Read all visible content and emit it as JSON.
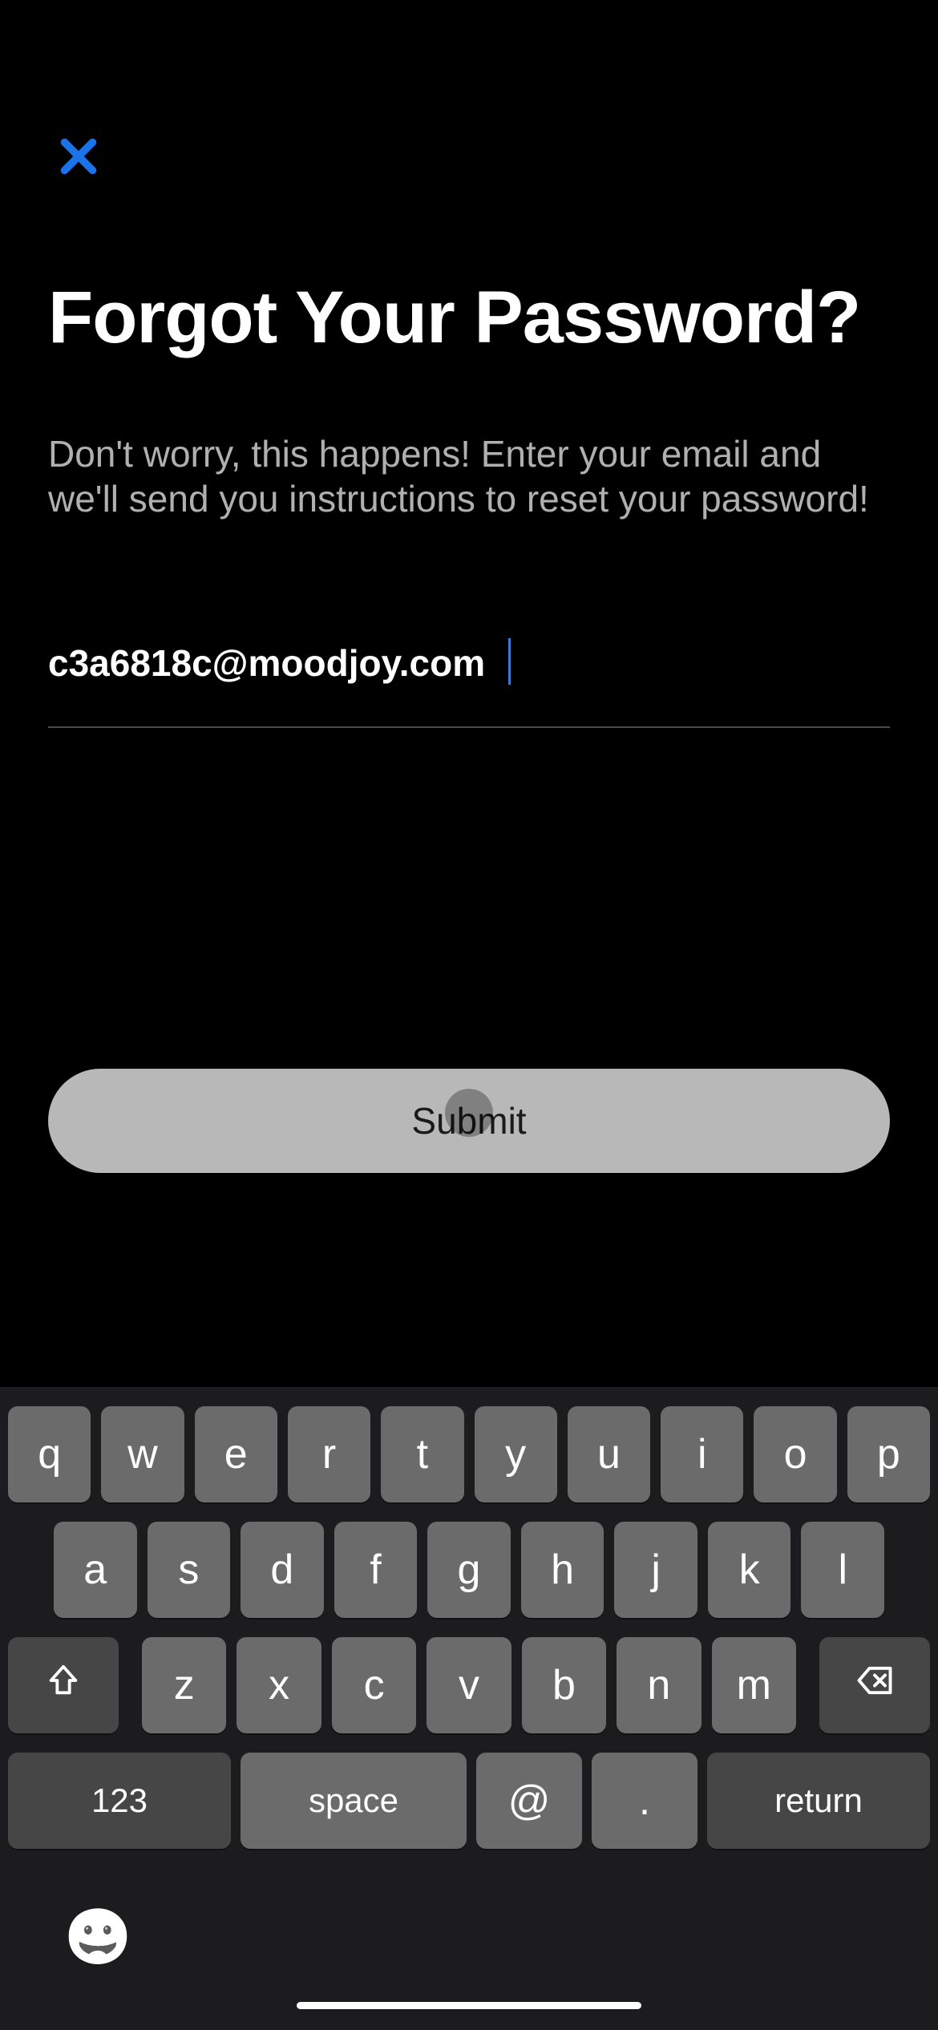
{
  "header": {
    "close_icon": "close-x"
  },
  "page": {
    "title": "Forgot Your Password?",
    "subtitle": "Don't worry, this happens! Enter your email and we'll send you instructions to reset your password!"
  },
  "form": {
    "email_value": "c3a6818c@moodjoy.com",
    "submit_label": "Submit"
  },
  "keyboard": {
    "row1": [
      "q",
      "w",
      "e",
      "r",
      "t",
      "y",
      "u",
      "i",
      "o",
      "p"
    ],
    "row2": [
      "a",
      "s",
      "d",
      "f",
      "g",
      "h",
      "j",
      "k",
      "l"
    ],
    "row3": [
      "z",
      "x",
      "c",
      "v",
      "b",
      "n",
      "m"
    ],
    "numbers_label": "123",
    "space_label": "space",
    "at_label": "@",
    "dot_label": ".",
    "return_label": "return"
  }
}
